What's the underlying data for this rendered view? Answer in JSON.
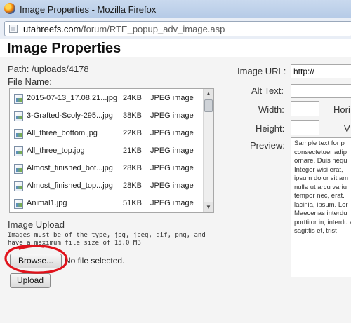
{
  "window": {
    "title": "Image Properties - Mozilla Firefox"
  },
  "urlbar": {
    "host": "utahreefs.com",
    "path": "/forum/RTE_popup_adv_image.asp"
  },
  "page": {
    "title": "Image Properties",
    "path_label": "Path: /uploads/4178",
    "filename_label": "File Name:"
  },
  "files": [
    {
      "name": "2015-07-13_17.08.21...jpg",
      "size": "24KB",
      "type": "JPEG image"
    },
    {
      "name": "3-Grafted-Scoly-295...jpg",
      "size": "38KB",
      "type": "JPEG image"
    },
    {
      "name": "All_three_bottom.jpg",
      "size": "22KB",
      "type": "JPEG image"
    },
    {
      "name": "All_three_top.jpg",
      "size": "21KB",
      "type": "JPEG image"
    },
    {
      "name": "Almost_finished_bot...jpg",
      "size": "28KB",
      "type": "JPEG image"
    },
    {
      "name": "Almost_finished_top...jpg",
      "size": "28KB",
      "type": "JPEG image"
    },
    {
      "name": "Animal1.jpg",
      "size": "51KB",
      "type": "JPEG image"
    }
  ],
  "upload": {
    "heading": "Image Upload",
    "note": "Images must be of the type, jpg, jpeg, gif, png, and have a maximum file size of 15.0 MB",
    "browse_label": "Browse...",
    "no_file_text": "No file selected.",
    "upload_label": "Upload"
  },
  "form": {
    "image_url_label": "Image URL:",
    "image_url_value": "http://",
    "alt_text_label": "Alt Text:",
    "width_label": "Width:",
    "horizontal_label": "Hori",
    "height_label": "Height:",
    "vertical_label": "V",
    "preview_label": "Preview:",
    "preview_text": "Sample text for p consectetuer adip ornare. Duis nequ Integer wisi erat, ipsum dolor sit am nulla ut arcu variu tempor nec, erat. lacinia, ipsum. Lor Maecenas interdu porttitor in, interdu at, sagittis et, trist"
  },
  "colors": {
    "highlight": "#e0121b",
    "titlebar": "#c9d9ee"
  }
}
